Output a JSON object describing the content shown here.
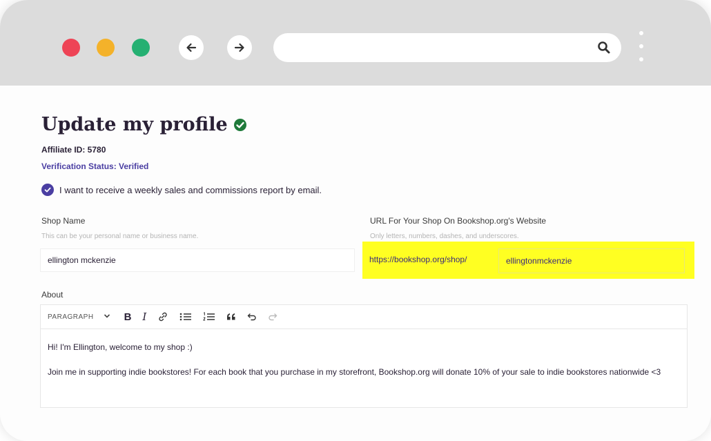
{
  "colors": {
    "accent": "#4a3ea2",
    "title": "#2a2136",
    "highlight": "#ffff22",
    "verified_green": "#1f7a3a",
    "close": "#ee4456",
    "minimize": "#f4b22a",
    "maximize": "#25b072"
  },
  "browser": {
    "url": "",
    "icons": [
      "back-arrow-icon",
      "forward-arrow-icon",
      "search-icon",
      "more-menu-icon"
    ]
  },
  "profile": {
    "title": "Update my profile",
    "affiliate_id": "Affiliate ID: 5780",
    "verification_status": "Verification Status: Verified",
    "weekly_report": {
      "checked": true,
      "label": "I want to receive a weekly sales and commissions report by email."
    },
    "shop_name": {
      "label": "Shop Name",
      "hint": "This can be your personal name or business name.",
      "value": "ellington mckenzie"
    },
    "shop_url": {
      "label": "URL For Your Shop On Bookshop.org's Website",
      "hint": "Only letters, numbers, dashes, and underscores.",
      "prefix": "https://bookshop.org/shop/",
      "value": "ellingtonmckenzie"
    },
    "about": {
      "label": "About",
      "format_select": "PARAGRAPH",
      "paragraphs": [
        "Hi! I'm Ellington, welcome to my shop :)",
        "Join me in supporting indie bookstores! For each book that you purchase in my storefront, Bookshop.org will donate 10% of your sale to indie bookstores nationwide <3"
      ]
    }
  }
}
